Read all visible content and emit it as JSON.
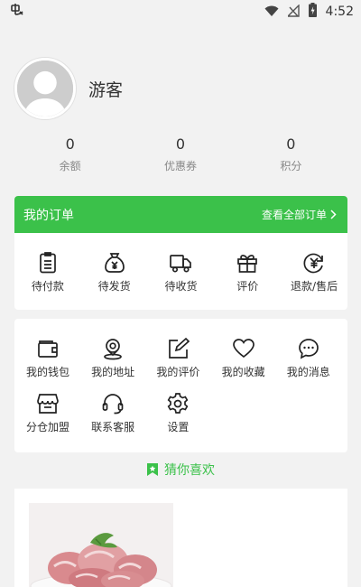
{
  "status_bar": {
    "time": "4:52",
    "icons": [
      "bug-icon",
      "wifi-icon",
      "no-signal-icon",
      "battery-charging-icon"
    ]
  },
  "profile": {
    "username": "游客"
  },
  "stats": [
    {
      "value": "0",
      "label": "余额"
    },
    {
      "value": "0",
      "label": "优惠券"
    },
    {
      "value": "0",
      "label": "积分"
    }
  ],
  "orders": {
    "title": "我的订单",
    "view_all": "查看全部订单",
    "items": [
      {
        "label": "待付款",
        "icon": "clipboard-icon"
      },
      {
        "label": "待发货",
        "icon": "money-bag-icon"
      },
      {
        "label": "待收货",
        "icon": "truck-icon"
      },
      {
        "label": "评价",
        "icon": "gift-icon"
      },
      {
        "label": "退款/售后",
        "icon": "refund-icon"
      }
    ]
  },
  "services": {
    "items": [
      {
        "label": "我的钱包",
        "icon": "wallet-icon"
      },
      {
        "label": "我的地址",
        "icon": "location-icon"
      },
      {
        "label": "我的评价",
        "icon": "edit-icon"
      },
      {
        "label": "我的收藏",
        "icon": "heart-icon"
      },
      {
        "label": "我的消息",
        "icon": "message-icon"
      },
      {
        "label": "分仓加盟",
        "icon": "store-icon"
      },
      {
        "label": "联系客服",
        "icon": "headset-icon"
      },
      {
        "label": "设置",
        "icon": "settings-icon"
      }
    ]
  },
  "recommend": {
    "title": "猜你喜欢"
  },
  "colors": {
    "accent": "#3bc14a",
    "background": "#f2f2f2"
  }
}
